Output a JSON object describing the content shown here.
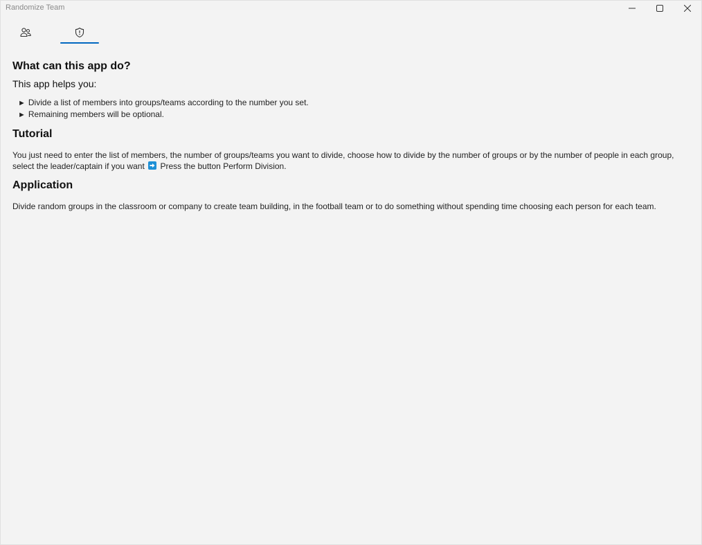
{
  "window": {
    "title": "Randomize Team",
    "minimize_icon": "minimize-icon",
    "maximize_icon": "maximize-icon",
    "close_icon": "close-icon"
  },
  "tabs": [
    {
      "icon": "people-icon",
      "selected": false
    },
    {
      "icon": "shield-icon",
      "selected": true
    }
  ],
  "about": {
    "heading": "What can this app do?",
    "intro": "This app helps you:",
    "bullet_mark": "►",
    "bullets": [
      "Divide a list of members into groups/teams according to the number you set.",
      "Remaining members will be optional."
    ],
    "tutorial_heading": "Tutorial",
    "tutorial_text_before": "You just need to enter the list of members, the number of groups/teams you want to divide, choose how to divide by the number of groups or by the number of people in each group, select the leader/captain if you want",
    "tutorial_arrow_icon": "right-arrow-icon",
    "tutorial_text_after": "Press the button Perform Division.",
    "application_heading": "Application",
    "application_text": "Divide random groups in the classroom or company to create team building, in the football team or to do something without spending time choosing each person for each team."
  },
  "colors": {
    "accent": "#0067c0",
    "background": "#f3f3f3",
    "arrow_emoji": "#1e90d6"
  }
}
